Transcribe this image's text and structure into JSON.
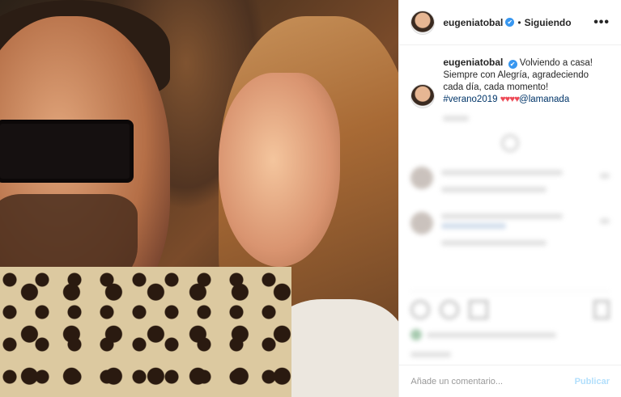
{
  "header": {
    "username": "eugeniatobal",
    "verified_glyph": "✔",
    "separator": "•",
    "follow_status": "Siguiendo",
    "more_glyph": "•••"
  },
  "caption": {
    "username": "eugeniatobal",
    "verified_glyph": "✔",
    "text": "Volviendo a casa! Siempre con Alegría, agradeciendo cada día, cada momento!",
    "hashtag": "#verano2019",
    "hearts": "♥♥♥♥",
    "mention": "@lamanada"
  },
  "comment_box": {
    "placeholder": "Añade un comentario...",
    "publish_label": "Publicar"
  },
  "icons": [
    "verified-icon",
    "more-options-icon",
    "heart-icon",
    "comment-icon",
    "share-icon",
    "save-icon"
  ],
  "colors": {
    "link": "#003569",
    "verified": "#3897f0",
    "heart": "#ed4956",
    "publish": "#b2dffc"
  }
}
